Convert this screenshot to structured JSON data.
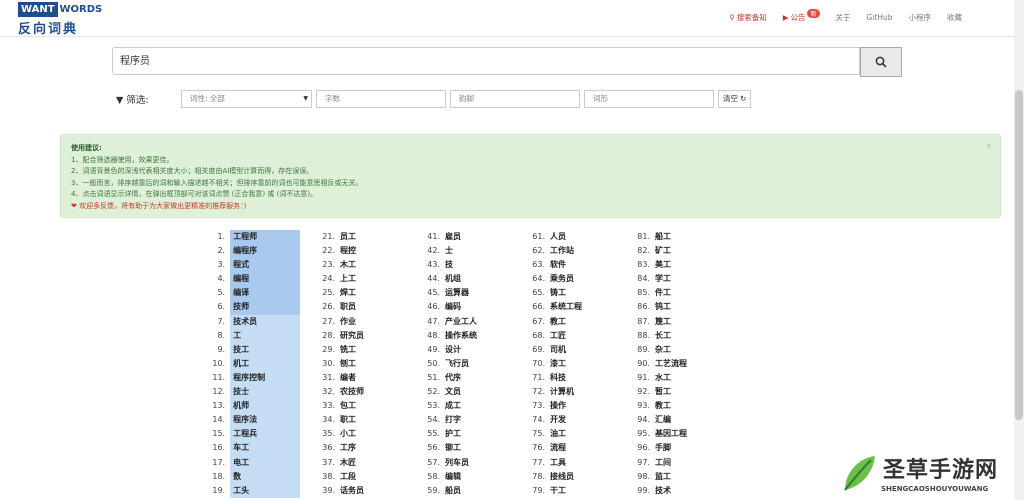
{
  "logo": {
    "want": "WANT",
    "words": "WORDS",
    "cn": "反向词典"
  },
  "nav": {
    "feedback": "搜索备知",
    "notice": "公告",
    "notice_badge": "新",
    "about": "关于",
    "github": "GitHub",
    "mini": "小程序",
    "donate": "收藏"
  },
  "search": {
    "value": "程序员"
  },
  "filter": {
    "label": "筛选:",
    "pos": "词性: 全部",
    "chars": "字数",
    "rhyme": "韵脚",
    "form": "词形",
    "clear": "清空"
  },
  "tips": {
    "title": "使用建议:",
    "lines": [
      "1、配合筛选器使用，效果更佳。",
      "2、词语背景色的深浅代表相关度大小；相关度由AI模型计算而得，存在误误。",
      "3、一般而言，排序越靠后的词和输入描述越不相关；但排序靠前的词也可能意思相反或无关。",
      "4、点击词语显示详情，在弹出框顶部可对该词点赞 (正合我意) 或 (词不达意)。",
      "❤ 欢迎多反馈，将有助于为大家做出更精准的推荐服务：)"
    ]
  },
  "results": [
    [
      "1.",
      "工程师"
    ],
    [
      "2.",
      "编程序"
    ],
    [
      "3.",
      "程式"
    ],
    [
      "4.",
      "编程"
    ],
    [
      "5.",
      "编译"
    ],
    [
      "6.",
      "技师"
    ],
    [
      "7.",
      "技术员"
    ],
    [
      "8.",
      "工"
    ],
    [
      "9.",
      "技工"
    ],
    [
      "10.",
      "机工"
    ],
    [
      "11.",
      "程序控制"
    ],
    [
      "12.",
      "技士"
    ],
    [
      "13.",
      "机师"
    ],
    [
      "14.",
      "程序法"
    ],
    [
      "15.",
      "工程兵"
    ],
    [
      "16.",
      "车工"
    ],
    [
      "17.",
      "电工"
    ],
    [
      "18.",
      "数"
    ],
    [
      "19.",
      "工头"
    ],
    [
      "21.",
      "员工"
    ],
    [
      "22.",
      "程控"
    ],
    [
      "23.",
      "木工"
    ],
    [
      "24.",
      "上工"
    ],
    [
      "25.",
      "焊工"
    ],
    [
      "26.",
      "职员"
    ],
    [
      "27.",
      "作业"
    ],
    [
      "28.",
      "研究员"
    ],
    [
      "29.",
      "铣工"
    ],
    [
      "30.",
      "刨工"
    ],
    [
      "31.",
      "编者"
    ],
    [
      "32.",
      "农技师"
    ],
    [
      "33.",
      "包工"
    ],
    [
      "34.",
      "职工"
    ],
    [
      "35.",
      "小工"
    ],
    [
      "36.",
      "工序"
    ],
    [
      "37.",
      "木匠"
    ],
    [
      "38.",
      "工段"
    ],
    [
      "39.",
      "话务员"
    ],
    [
      "41.",
      "雇员"
    ],
    [
      "42.",
      "士"
    ],
    [
      "43.",
      "技"
    ],
    [
      "44.",
      "机组"
    ],
    [
      "45.",
      "运算器"
    ],
    [
      "46.",
      "编码"
    ],
    [
      "47.",
      "产业工人"
    ],
    [
      "48.",
      "操作系统"
    ],
    [
      "49.",
      "设计"
    ],
    [
      "50.",
      "飞行员"
    ],
    [
      "51.",
      "代序"
    ],
    [
      "52.",
      "文员"
    ],
    [
      "53.",
      "成工"
    ],
    [
      "54.",
      "打字"
    ],
    [
      "55.",
      "护工"
    ],
    [
      "56.",
      "铆工"
    ],
    [
      "57.",
      "列车员"
    ],
    [
      "58.",
      "编辑"
    ],
    [
      "59.",
      "船员"
    ],
    [
      "61.",
      "人员"
    ],
    [
      "62.",
      "工作站"
    ],
    [
      "63.",
      "软件"
    ],
    [
      "64.",
      "乘务员"
    ],
    [
      "65.",
      "铸工"
    ],
    [
      "66.",
      "系统工程"
    ],
    [
      "67.",
      "教工"
    ],
    [
      "68.",
      "工匠"
    ],
    [
      "69.",
      "司机"
    ],
    [
      "70.",
      "漆工"
    ],
    [
      "71.",
      "科技"
    ],
    [
      "72.",
      "计算机"
    ],
    [
      "73.",
      "操作"
    ],
    [
      "74.",
      "开发"
    ],
    [
      "75.",
      "油工"
    ],
    [
      "76.",
      "流程"
    ],
    [
      "77.",
      "工具"
    ],
    [
      "78.",
      "接线员"
    ],
    [
      "79.",
      "干工"
    ],
    [
      "81.",
      "船工"
    ],
    [
      "82.",
      "矿工"
    ],
    [
      "83.",
      "美工"
    ],
    [
      "84.",
      "学工"
    ],
    [
      "85.",
      "件工"
    ],
    [
      "86.",
      "钨工"
    ],
    [
      "87.",
      "篾工"
    ],
    [
      "88.",
      "长工"
    ],
    [
      "89.",
      "杂工"
    ],
    [
      "90.",
      "工艺流程"
    ],
    [
      "91.",
      "水工"
    ],
    [
      "92.",
      "暂工"
    ],
    [
      "93.",
      "教工"
    ],
    [
      "94.",
      "汇编"
    ],
    [
      "95.",
      "基因工程"
    ],
    [
      "96.",
      "手脚"
    ],
    [
      "97.",
      "工间"
    ],
    [
      "98.",
      "监工"
    ],
    [
      "99.",
      "技术"
    ]
  ],
  "watermark": {
    "title": "圣草手游网",
    "sub": "SHENGCAOSHOUYOUWANG"
  },
  "colors": {
    "accent": "#1f4e8c",
    "tips_bg": "#dff0d8",
    "highlight": "#a9c9ee"
  }
}
